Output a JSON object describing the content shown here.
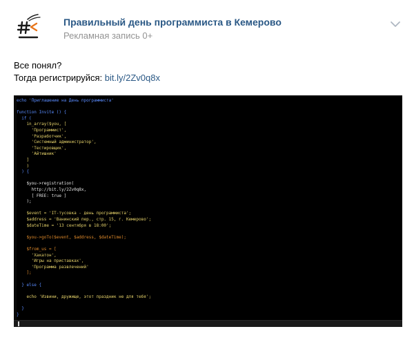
{
  "post": {
    "group_name": "Правильный день программиста в Кемерово",
    "ad_label": "Рекламная запись 0+",
    "text_line_1": "Все понял?",
    "text_line_2_prefix": "Тогда регистрируйся: ",
    "link_text": "bit.ly/2Zv0q8x",
    "avatar_icon": "hash-arrow-logo-icon",
    "menu_icon": "chevron-down-icon"
  },
  "colors": {
    "link": "#2a5885",
    "muted": "#939393",
    "code_bg": "#000000",
    "code_blue": "#5a8cff",
    "code_yellow": "#e6d26a",
    "code_orange": "#e08a2a",
    "code_white": "#e8e8e8",
    "code_green": "#7fd07f"
  },
  "code": {
    "lines": [
      {
        "text": "echo 'Приглашение на День программиста'",
        "color": "blue"
      },
      {
        "text": "",
        "color": "white"
      },
      {
        "text": "function Invite () {",
        "color": "blue"
      },
      {
        "text": "  if (",
        "color": "blue"
      },
      {
        "text": "    in_array($you, [",
        "color": "yellow"
      },
      {
        "text": "      'Программист',",
        "color": "yellow"
      },
      {
        "text": "      'Разработчик',",
        "color": "yellow"
      },
      {
        "text": "      'Системный администратор',",
        "color": "yellow"
      },
      {
        "text": "      'Тестировщик',",
        "color": "yellow"
      },
      {
        "text": "      'Айтишник'",
        "color": "yellow"
      },
      {
        "text": "    ]",
        "color": "yellow"
      },
      {
        "text": "    )",
        "color": "yellow"
      },
      {
        "text": "  ) {",
        "color": "blue"
      },
      {
        "text": "",
        "color": "white"
      },
      {
        "text": "    $you->registration(",
        "color": "white"
      },
      {
        "text": "      http://bit.ly/2Zv0q8x,",
        "color": "white"
      },
      {
        "text": "      [ FREE: true ]",
        "color": "white"
      },
      {
        "text": "    );",
        "color": "white"
      },
      {
        "text": "",
        "color": "white"
      },
      {
        "text": "    $event = 'IT-тусовка - день программиста';",
        "color": "yellow"
      },
      {
        "text": "    $address = 'Ванинский пер., стр. 15, г. Кемерово';",
        "color": "yellow"
      },
      {
        "text": "    $dateTime = '13 сентября в 18:00';",
        "color": "yellow"
      },
      {
        "text": "",
        "color": "white"
      },
      {
        "text": "    $you->goTo($event, $address, $dateTime);",
        "color": "orange"
      },
      {
        "text": "",
        "color": "white"
      },
      {
        "text": "    $from_us = [",
        "color": "orange"
      },
      {
        "text": "      'Хакатон',",
        "color": "yellow"
      },
      {
        "text": "      'Игры на приставках',",
        "color": "yellow"
      },
      {
        "text": "      'Программа развлечений'",
        "color": "yellow"
      },
      {
        "text": "    ];",
        "color": "orange"
      },
      {
        "text": "",
        "color": "white"
      },
      {
        "text": "  } else {",
        "color": "blue"
      },
      {
        "text": "",
        "color": "white"
      },
      {
        "text": "    echo 'Извини, дружище, этот праздник не для тебя';",
        "color": "yellow"
      },
      {
        "text": "",
        "color": "white"
      },
      {
        "text": "  }",
        "color": "blue"
      },
      {
        "text": "}",
        "color": "blue"
      }
    ]
  }
}
